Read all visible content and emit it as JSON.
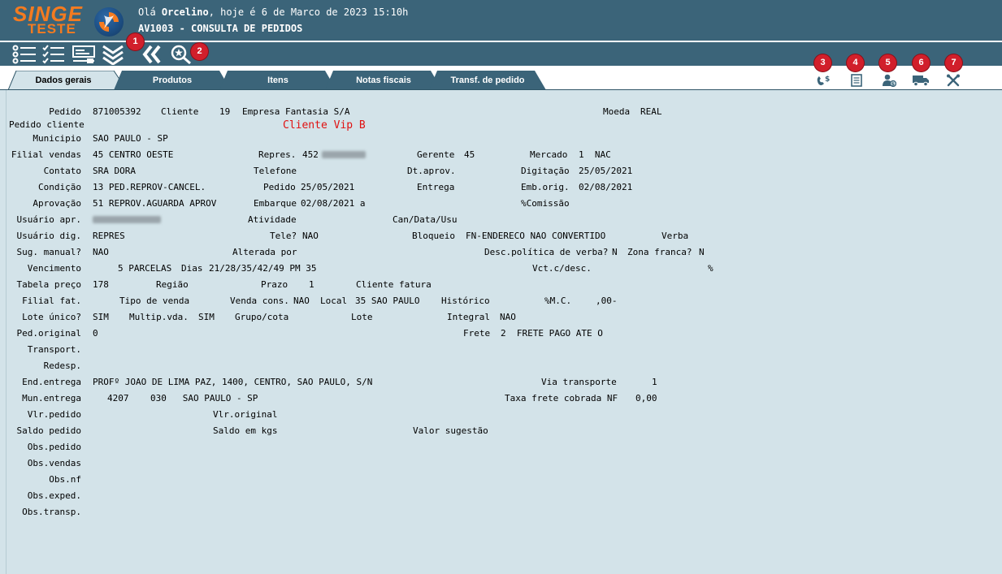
{
  "header": {
    "logo_line1": "SINGE",
    "logo_line2": "TESTE",
    "greeting_prefix": "Olá ",
    "user": "Orcelino",
    "greeting_suffix": ", hoje é 6 de Marco de 2023 15:10h",
    "title": "AV1003 - CONSULTA DE PEDIDOS"
  },
  "toolbar": {
    "icons": [
      "list-icon",
      "checklist-icon",
      "form-icon",
      "expand-down-icon",
      "back-icon",
      "search-icon"
    ],
    "badges": [
      "1",
      "2"
    ]
  },
  "tabs": [
    "Dados gerais",
    "Produtos",
    "Itens",
    "Notas fiscais",
    "Transf. de pedido"
  ],
  "right_actions": {
    "badges": [
      "3",
      "4",
      "5",
      "6",
      "7"
    ],
    "icons": [
      "phone-money-icon",
      "document-icon",
      "person-money-icon",
      "truck-icon",
      "tools-icon"
    ]
  },
  "colors": {
    "header": "#3b6479",
    "content": "#d3e3e9",
    "badge": "#d11f2b",
    "accent_text": "#e01010",
    "logo": "#f47b20"
  },
  "form": {
    "pedido_label": "Pedido",
    "pedido": "871005392",
    "cliente_label": "Cliente",
    "cliente_cod": "19",
    "cliente_nome": "Empresa Fantasia S/A",
    "moeda_label": "Moeda",
    "moeda": "REAL",
    "pedido_cliente_label": "Pedido cliente",
    "cliente_vip": "Cliente Vip B",
    "municipio_label": "Municipio",
    "municipio": "SAO PAULO - SP",
    "filial_vendas_label": "Filial vendas",
    "filial_vendas": "45 CENTRO OESTE",
    "repres_label": "Repres.",
    "repres": "452",
    "gerente_label": "Gerente",
    "gerente": "45",
    "mercado_label": "Mercado",
    "mercado": "1  NAC",
    "contato_label": "Contato",
    "contato": "SRA DORA",
    "telefone_label": "Telefone",
    "dt_aprov_label": "Dt.aprov.",
    "digitacao_label": "Digitação",
    "digitacao": "25/05/2021",
    "condicao_label": "Condição",
    "condicao": "13 PED.REPROV-CANCEL.",
    "pedido_data_label": "Pedido",
    "pedido_data": "25/05/2021",
    "entrega_label": "Entrega",
    "emb_orig_label": "Emb.orig.",
    "emb_orig": "02/08/2021",
    "aprovacao_label": "Aprovação",
    "aprovacao": "51 REPROV.AGUARDA APROV",
    "embarque_label": "Embarque",
    "embarque": "02/08/2021 a",
    "comissao_label": "%Comissão",
    "usuario_apr_label": "Usuário apr.",
    "atividade_label": "Atividade",
    "can_data_usu_label": "Can/Data/Usu",
    "usuario_dig_label": "Usuário dig.",
    "usuario_dig": "REPRES",
    "tele_label": "Tele?",
    "tele": "NAO",
    "bloqueio_label": "Bloqueio",
    "bloqueio": "FN-ENDERECO NAO CONVERTIDO",
    "verba_label": "Verba",
    "sug_manual_label": "Sug. manual?",
    "sug_manual": "NAO",
    "alterada_por_label": "Alterada por",
    "desc_politica_label": "Desc.política de verba?",
    "desc_politica": "N",
    "zona_franca_label": "Zona franca?",
    "zona_franca": "N",
    "vencimento_label": "Vencimento",
    "vencimento": "5 PARCELAS",
    "dias_label": "Dias",
    "dias": "21/28/35/42/49 PM 35",
    "vct_desc_label": "Vct.c/desc.",
    "vct_desc_pct": "%",
    "tabela_preco_label": "Tabela preço",
    "tabela_preco": "178",
    "regiao_label": "Região",
    "prazo_label": "Prazo",
    "prazo": "1",
    "cliente_fatura_label": "Cliente fatura",
    "filial_fat_label": "Filial fat.",
    "tipo_venda_label": "Tipo de venda",
    "venda_cons_label": "Venda cons.",
    "venda_cons": "NAO",
    "local_label": "Local",
    "local": "35 SAO PAULO",
    "historico_label": "Histórico",
    "mc_label": "%M.C.",
    "mc": ",00-",
    "lote_unico_label": "Lote único?",
    "lote_unico": "SIM",
    "multip_vda_label": "Multip.vda.",
    "multip_vda": "SIM",
    "grupo_cota_label": "Grupo/cota",
    "lote_label": "Lote",
    "integral_label": "Integral",
    "integral": "NAO",
    "ped_original_label": "Ped.original",
    "ped_original": "0",
    "frete_label": "Frete",
    "frete": "2  FRETE PAGO ATE O",
    "transport_label": "Transport.",
    "redesp_label": "Redesp.",
    "end_entrega_label": "End.entrega",
    "end_entrega": "PROFº JOAO DE LIMA PAZ, 1400, CENTRO, SAO PAULO, S/N",
    "via_transporte_label": "Via transporte",
    "via_transporte": "1",
    "mun_entrega_label": "Mun.entrega",
    "mun_entrega": "4207    030   SAO PAULO - SP",
    "taxa_frete_label": "Taxa frete cobrada NF",
    "taxa_frete": "0,00",
    "vlr_pedido_label": "Vlr.pedido",
    "vlr_original_label": "Vlr.original",
    "saldo_pedido_label": "Saldo pedido",
    "saldo_kgs_label": "Saldo em kgs",
    "valor_sugestao_label": "Valor sugestão",
    "obs_pedido_label": "Obs.pedido",
    "obs_vendas_label": "Obs.vendas",
    "obs_nf_label": "Obs.nf",
    "obs_exped_label": "Obs.exped.",
    "obs_transp_label": "Obs.transp."
  }
}
